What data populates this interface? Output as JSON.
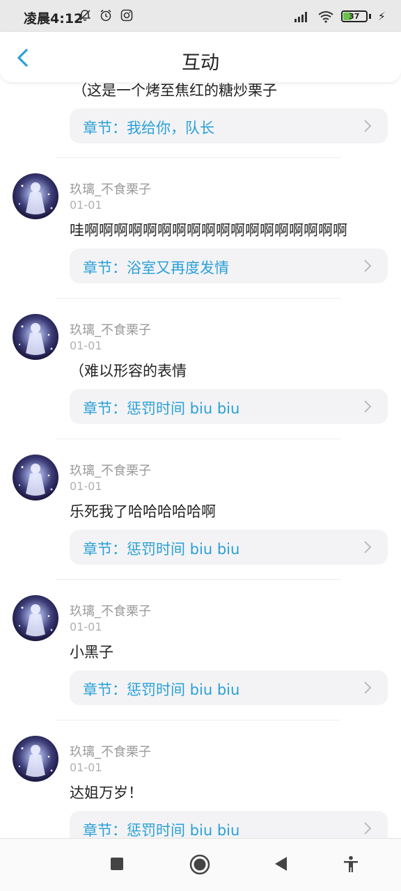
{
  "status_bar": {
    "time": "凌晨4:12",
    "battery": "37",
    "icons": [
      "bell-off-icon",
      "alarm-icon",
      "instagram-icon",
      "signal-icon",
      "wifi-icon",
      "battery-icon",
      "charging-icon"
    ]
  },
  "header": {
    "title": "互动",
    "back_icon": "chevron-left-icon",
    "accent_color": "#2aa0d8"
  },
  "partial_comment": {
    "text": "（这是一个烤至焦红的糖炒栗子",
    "chapter": "章节：我给你，队长"
  },
  "comments": [
    {
      "username": "玖璃_不食栗子",
      "date": "01-01",
      "text": "哇啊啊啊啊啊啊啊啊啊啊啊啊啊啊啊啊啊啊",
      "chapter": "章节：浴室又再度发情"
    },
    {
      "username": "玖璃_不食栗子",
      "date": "01-01",
      "text": "（难以形容的表情",
      "chapter": "章节：惩罚时间 biu biu"
    },
    {
      "username": "玖璃_不食栗子",
      "date": "01-01",
      "text": "乐死我了哈哈哈哈哈啊",
      "chapter": "章节：惩罚时间 biu biu"
    },
    {
      "username": "玖璃_不食栗子",
      "date": "01-01",
      "text": "小黑子",
      "chapter": "章节：惩罚时间 biu biu"
    },
    {
      "username": "玖璃_不食栗子",
      "date": "01-01",
      "text": "达姐万岁！",
      "chapter": "章节：惩罚时间 biu biu"
    }
  ],
  "nav_bar": {
    "buttons": [
      "recent-apps-icon",
      "home-icon",
      "back-icon",
      "accessibility-icon"
    ]
  }
}
